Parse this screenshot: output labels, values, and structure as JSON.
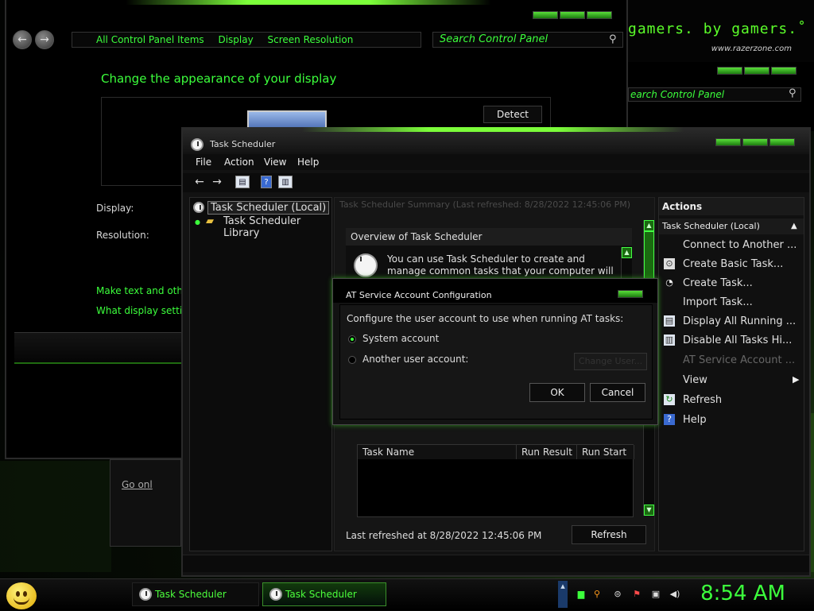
{
  "background": {
    "razer_tagline": "gamers. by gamers.˚",
    "razer_url": "www.razerzone.com",
    "razer_search_placeholder": "earch Control Panel"
  },
  "control_panel": {
    "breadcrumb": [
      "All Control Panel Items",
      "Display",
      "Screen Resolution"
    ],
    "search_placeholder": "Search Control Panel",
    "heading": "Change the appearance of your display",
    "detect_label": "Detect",
    "display_label": "Display:",
    "resolution_label": "Resolution:",
    "link_text_size": "Make text and other",
    "link_display_settings": "What display setting",
    "go_online": "Go onl"
  },
  "task_scheduler": {
    "title": "Task Scheduler",
    "menu": [
      "File",
      "Action",
      "View",
      "Help"
    ],
    "tree": {
      "local": "Task Scheduler (Local)",
      "library": "Task Scheduler Library"
    },
    "summary_header": "Task Scheduler Summary (Last refreshed: 8/28/2022 12:45:06 PM)",
    "overview_header": "Overview of Task Scheduler",
    "overview_text": "You can use Task Scheduler to create and manage common tasks that your computer will carry out",
    "table_columns": [
      "Task Name",
      "Run Result",
      "Run Start"
    ],
    "last_refreshed": "Last refreshed at 8/28/2022 12:45:06 PM",
    "refresh_button": "Refresh",
    "actions": {
      "header": "Actions",
      "subheader": "Task Scheduler (Local)",
      "items": [
        "Connect to Another ...",
        "Create Basic Task...",
        "Create Task...",
        "Import Task...",
        "Display All Running ...",
        "Disable All Tasks Hi...",
        "AT Service Account ...",
        "View",
        "Refresh",
        "Help"
      ]
    }
  },
  "at_dialog": {
    "title": "AT Service Account Configuration",
    "prompt": "Configure the user account to use when running AT tasks:",
    "option_system": "System account",
    "option_other": "Another user account:",
    "change_user": "Change User...",
    "ok": "OK",
    "cancel": "Cancel"
  },
  "taskbar": {
    "items": [
      "Task Scheduler",
      "Task Scheduler"
    ],
    "clock": "8:54 AM"
  },
  "colors": {
    "accent_green": "#3cff3c",
    "window_bg": "#121212"
  }
}
